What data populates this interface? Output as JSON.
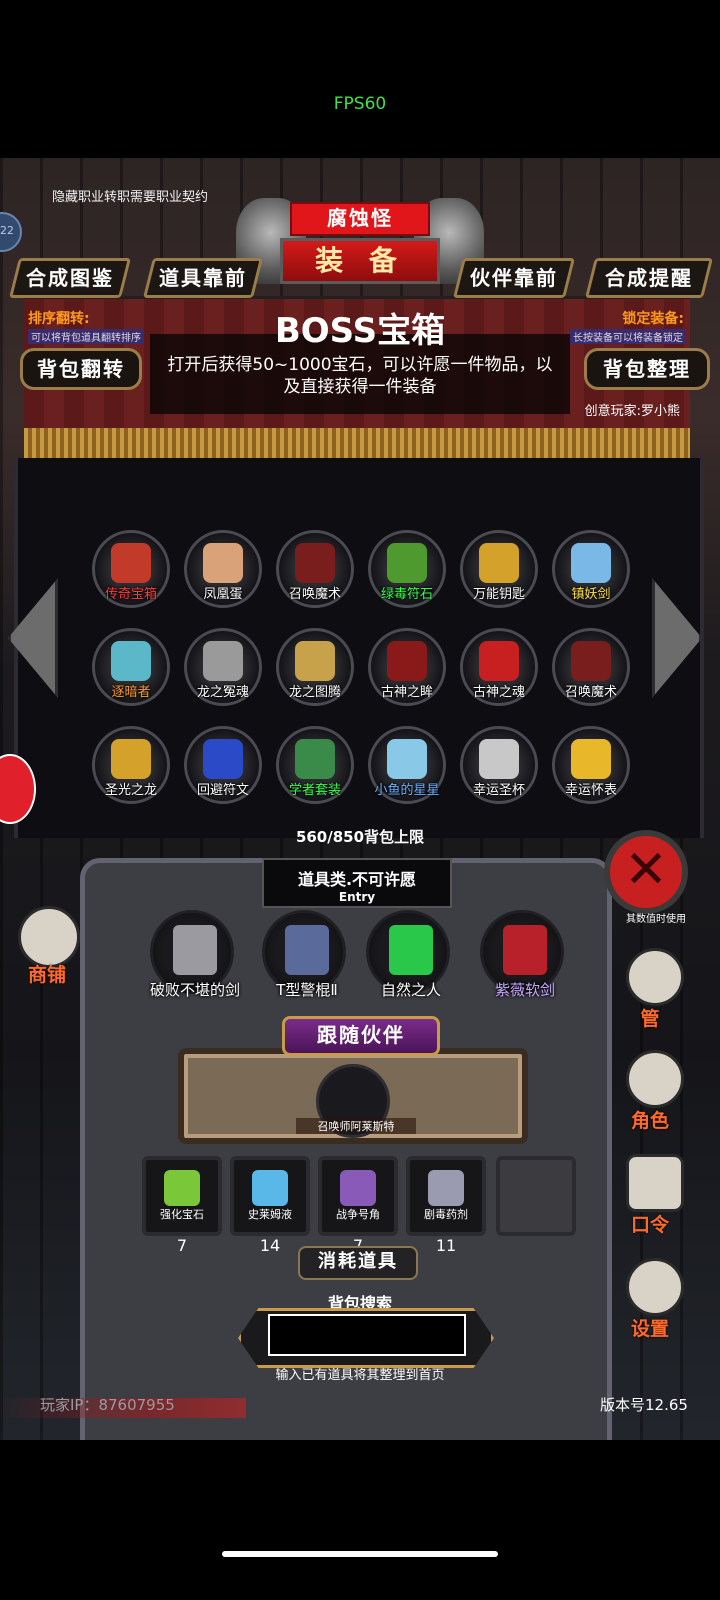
{
  "status": {
    "fps": "FPS60"
  },
  "hint_top": "隐藏职业转职需要职业契约",
  "side_badge": "22",
  "title": {
    "sub": "腐蚀怪",
    "main": "装 备"
  },
  "tabs": [
    "合成图鉴",
    "道具靠前",
    "伙伴靠前",
    "合成提醒"
  ],
  "banner": {
    "sort_label": "排序翻转:",
    "sort_hint": "可以将背包道具翻转排序",
    "lock_label": "锁定装备:",
    "lock_hint": "长按装备可以将装备锁定",
    "item_title": "BOSS宝箱",
    "item_desc": "打开后获得50~1000宝石，可以许愿一件物品，以及直接获得一件装备",
    "creator": "创意玩家:罗小熊",
    "flip_button": "背包翻转",
    "tidy_button": "背包整理"
  },
  "inventory": [
    {
      "label": "传奇宝箱",
      "color": "#c23a2a",
      "label_color": "#ff3a3a"
    },
    {
      "label": "凤凰蛋",
      "color": "#d9a278",
      "label_color": "#ffffff"
    },
    {
      "label": "召唤魔术",
      "color": "#7a1d1d",
      "label_color": "#ffffff"
    },
    {
      "label": "绿毒符石",
      "color": "#4e9a2e",
      "label_color": "#3aff4a"
    },
    {
      "label": "万能钥匙",
      "color": "#d4a12a",
      "label_color": "#ffffff"
    },
    {
      "label": "镇妖剑",
      "color": "#7ab8e8",
      "label_color": "#ffe24a"
    },
    {
      "label": "逐暗者",
      "color": "#5ab8c8",
      "label_color": "#ff9a2a"
    },
    {
      "label": "龙之冤魂",
      "color": "#9a9a9a",
      "label_color": "#ffffff"
    },
    {
      "label": "龙之图腾",
      "color": "#c8a24a",
      "label_color": "#ffffff"
    },
    {
      "label": "古神之眸",
      "color": "#8a1a1a",
      "label_color": "#ffffff"
    },
    {
      "label": "古神之魂",
      "color": "#c82020",
      "label_color": "#ffffff"
    },
    {
      "label": "召唤魔术",
      "color": "#7a1d1d",
      "label_color": "#ffffff"
    },
    {
      "label": "圣光之龙",
      "color": "#d4a12a",
      "label_color": "#ffffff"
    },
    {
      "label": "回避符文",
      "color": "#2a4ac8",
      "label_color": "#ffffff"
    },
    {
      "label": "学者套装",
      "color": "#3a8a4a",
      "label_color": "#3aff4a"
    },
    {
      "label": "小鱼的星星",
      "color": "#8ac8e8",
      "label_color": "#6ab0ff"
    },
    {
      "label": "幸运圣杯",
      "color": "#c8c8c8",
      "label_color": "#ffffff"
    },
    {
      "label": "幸运怀表",
      "color": "#e8b82a",
      "label_color": "#ffffff"
    }
  ],
  "capacity": "560/850背包上限",
  "category": {
    "text": "道具类.不可许愿",
    "sub": "Entry"
  },
  "equipment": [
    {
      "label": "破败不堪的剑",
      "color": "#9a9aa0",
      "label_color": "#ffffff"
    },
    {
      "label": "T型警棍Ⅱ",
      "color": "#5a6a9a",
      "label_color": "#ffffff"
    },
    {
      "label": "自然之人",
      "color": "#2ac84a",
      "label_color": "#ffffff"
    },
    {
      "label": "紫薇软剑",
      "color": "#b8202a",
      "label_color": "#c8a8ff"
    }
  ],
  "follow": {
    "title": "跟随伙伴",
    "pet": "召唤师阿莱斯特"
  },
  "consumables": [
    {
      "label": "强化宝石",
      "count": "7",
      "color": "#7ac83a"
    },
    {
      "label": "史莱姆液",
      "count": "14",
      "color": "#5ab8e8"
    },
    {
      "label": "战争号角",
      "count": "7",
      "color": "#8a5ab8"
    },
    {
      "label": "剧毒药剂",
      "count": "11",
      "color": "#9a9ab0"
    }
  ],
  "consumables_title": "消耗道具",
  "search": {
    "title": "背包搜索",
    "hint": "输入已有道具将其整理到首页",
    "value": ""
  },
  "footer": {
    "player_ip": "玩家IP：87607955",
    "version": "版本号12.65"
  },
  "right_menu": [
    "管",
    "角色",
    "口令",
    "设置"
  ],
  "rate_text": "其数值时使用",
  "shop": "商铺"
}
